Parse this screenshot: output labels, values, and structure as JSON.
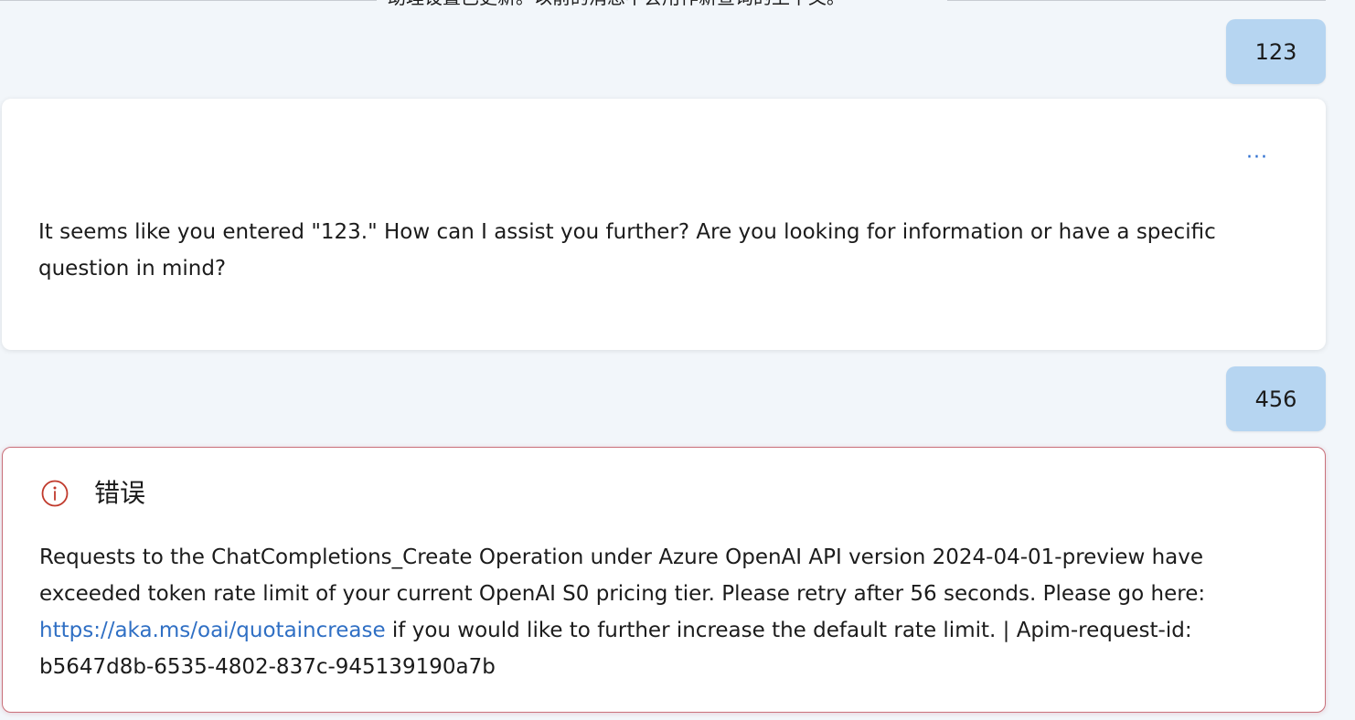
{
  "notice": {
    "text": "助理设置已更新。以前的消息不会用作新查询的上下文。"
  },
  "messages": {
    "user_1": "123",
    "assistant_1": "It seems like you entered \"123.\" How can I assist you further? Are you looking for information or have a specific question in mind?",
    "assistant_more": "···",
    "user_2": "456"
  },
  "error": {
    "title": "错误",
    "icon": "info-circle-icon",
    "color": "#c0392b",
    "text_before_link": "Requests to the ChatCompletions_Create Operation under Azure OpenAI API version 2024-04-01-preview have exceeded token rate limit of your current OpenAI S0 pricing tier. Please retry after 56 seconds. Please go here: ",
    "link": "https://aka.ms/oai/quotaincrease",
    "text_after_link": " if you would like to further increase the default rate limit. | Apim-request-id: b5647d8b-6535-4802-837c-945139190a7b"
  },
  "colors": {
    "user_bubble": "#b6d5f1",
    "background": "#f2f6fa",
    "link": "#2f6fc4",
    "error_border": "#c9707a"
  }
}
